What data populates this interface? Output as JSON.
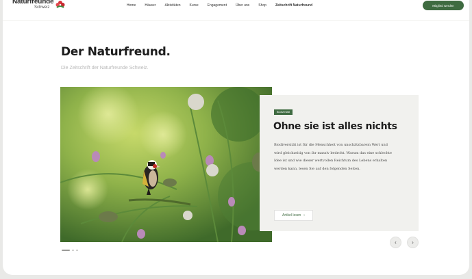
{
  "header": {
    "logo_text": "Naturfreunde",
    "logo_subtext": "Schweiz",
    "nav": [
      {
        "label": "Home"
      },
      {
        "label": "Häuser"
      },
      {
        "label": "Aktivitäten"
      },
      {
        "label": "Kurse"
      },
      {
        "label": "Engagement"
      },
      {
        "label": "Über uns"
      },
      {
        "label": "Shop"
      },
      {
        "label": "Zeitschrift Naturfreund"
      }
    ],
    "cta_label": "Mitglied werden"
  },
  "intro": {
    "title": "Der Naturfreund.",
    "subtitle": "Die Zeitschrift der Naturfreunde Schweiz."
  },
  "feature": {
    "tag": "Biodiversität",
    "title": "Ohne sie ist alles nichts",
    "body": "Biodiversität ist für die Menschheit von unschätzbarem Wert und wird gleichzeitig von ihr massiv bedroht. Warum das eine schlechte Idee ist und wie dieser wertvollen Reichtum des Lebens erhalten werden kann, lesen Sie auf den folgenden Seiten.",
    "read_label": "Artikel lesen",
    "image_alt": "goldfinch-on-thistle"
  },
  "carousel": {
    "prev_icon": "chevron-left-icon",
    "next_icon": "chevron-right-icon",
    "slide_count": 3,
    "active_slide": 1
  },
  "colors": {
    "brand_green": "#3f6b41",
    "card_bg": "#f1f1ee",
    "page_bg": "#e9e9e7"
  }
}
